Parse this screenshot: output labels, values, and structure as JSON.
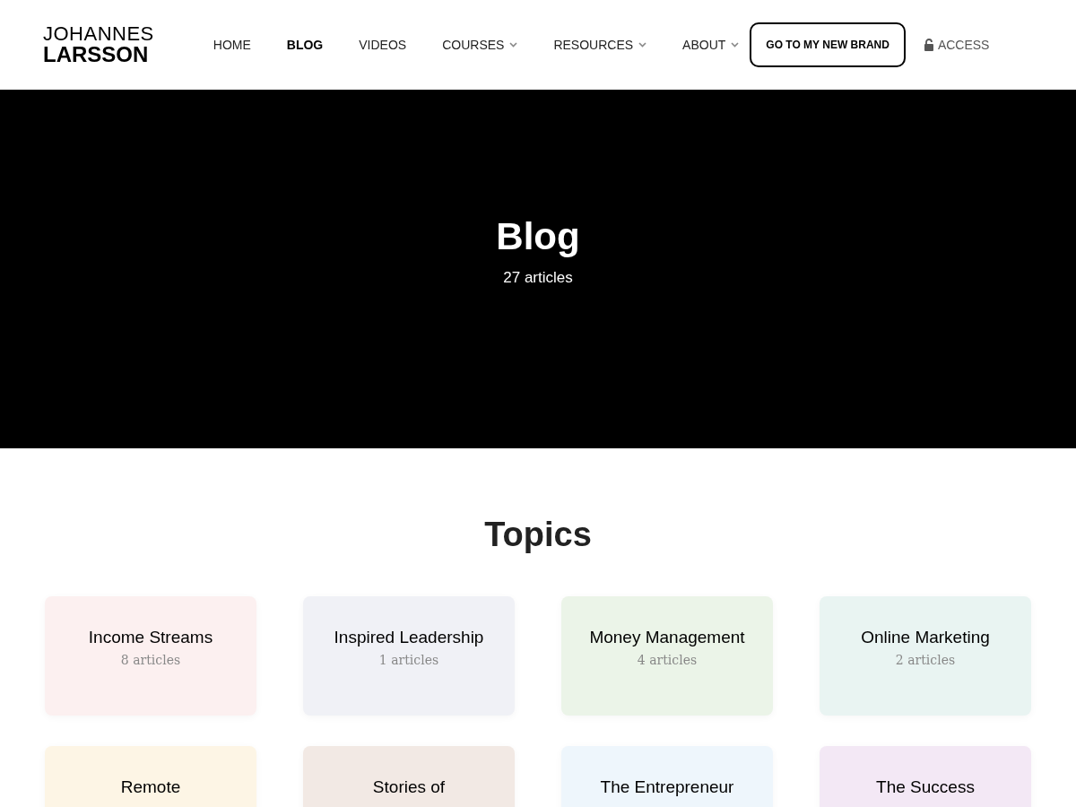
{
  "logo": {
    "line_1": "JOHANNES",
    "line_2": "LARSSON"
  },
  "nav": [
    {
      "label": "HOME",
      "selected": false,
      "dropdown": false
    },
    {
      "label": "BLOG",
      "selected": true,
      "dropdown": false
    },
    {
      "label": "VIDEOS",
      "selected": false,
      "dropdown": false
    },
    {
      "label": "COURSES",
      "selected": false,
      "dropdown": true
    },
    {
      "label": "RESOURCES",
      "selected": false,
      "dropdown": true
    },
    {
      "label": "ABOUT",
      "selected": false,
      "dropdown": true
    }
  ],
  "cta_button": "GO TO MY NEW BRAND",
  "access_link": "ACCESS",
  "hero": {
    "title": "Blog",
    "subtitle": "27 articles"
  },
  "topics": {
    "heading": "Topics",
    "cards": [
      {
        "title": "Income Streams",
        "count": "8 articles",
        "color": "#fcf0f0"
      },
      {
        "title": "Inspired Leadership",
        "count": "1 articles",
        "color": "#f0f1f6"
      },
      {
        "title": "Money Management",
        "count": "4 articles",
        "color": "#ebf4e8"
      },
      {
        "title": "Online Marketing",
        "count": "2 articles",
        "color": "#e9f4f2"
      },
      {
        "title": "Remote",
        "color": "#fdf5e5"
      },
      {
        "title": "Stories of",
        "color": "#f2e9e4"
      },
      {
        "title": "The Entrepreneur",
        "color": "#eef6fc"
      },
      {
        "title": "The Success",
        "color": "#f3e8f5"
      }
    ]
  }
}
